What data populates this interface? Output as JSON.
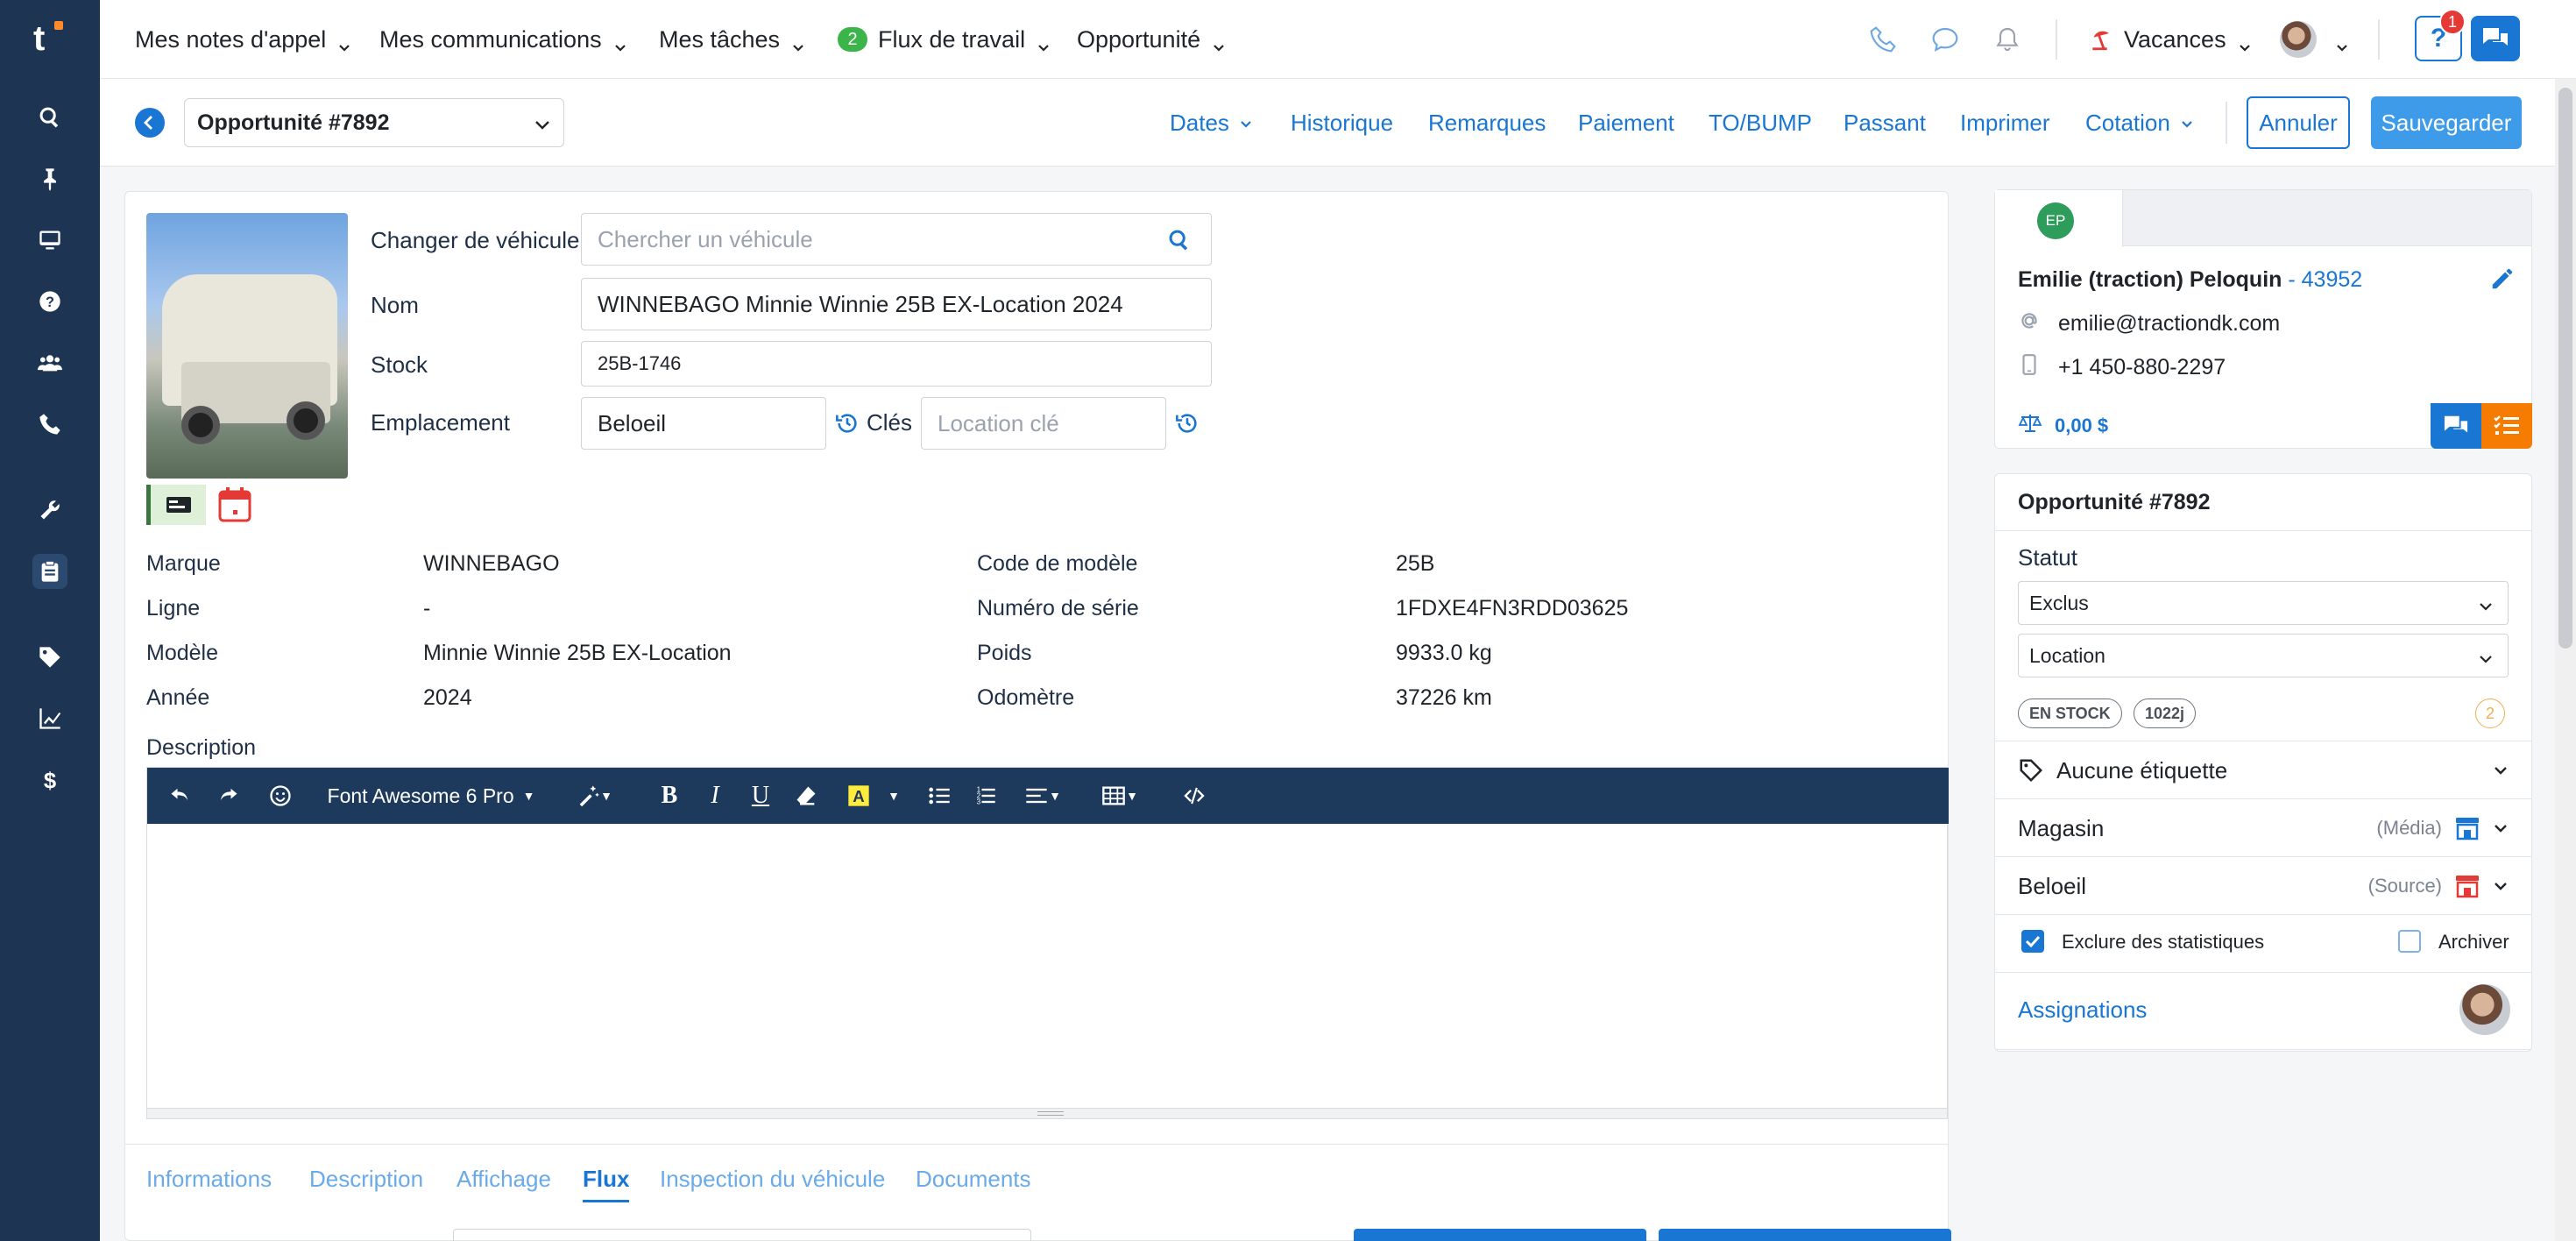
{
  "topnav": {
    "menus": [
      {
        "label": "Mes notes d'appel"
      },
      {
        "label": "Mes communications"
      },
      {
        "label": "Mes tâches"
      },
      {
        "label": "Flux de travail",
        "badge": "2"
      },
      {
        "label": "Opportunité"
      }
    ],
    "vacances_label": "Vacances",
    "help_label": "?",
    "notif_count": "1"
  },
  "subheader": {
    "opportunity_select": "Opportunité #7892",
    "tabs": [
      "Dates",
      "Historique",
      "Remarques",
      "Paiement",
      "TO/BUMP",
      "Passant",
      "Imprimer",
      "Cotation"
    ],
    "cancel_label": "Annuler",
    "save_label": "Sauvegarder"
  },
  "vehicle": {
    "change_label": "Changer de véhicule",
    "search_placeholder": "Chercher un véhicule",
    "nom_label": "Nom",
    "nom_value": "WINNEBAGO Minnie Winnie 25B EX-Location 2024",
    "stock_label": "Stock",
    "stock_value": "25B-1746",
    "emplacement_label": "Emplacement",
    "emplacement_value": "Beloeil",
    "cles_label": "Clés",
    "cles_placeholder": "Location clé"
  },
  "specs": {
    "left": [
      {
        "label": "Marque",
        "value": "WINNEBAGO"
      },
      {
        "label": "Ligne",
        "value": "-"
      },
      {
        "label": "Modèle",
        "value": "Minnie Winnie 25B EX-Location"
      },
      {
        "label": "Année",
        "value": "2024"
      }
    ],
    "right": [
      {
        "label": "Code de modèle",
        "value": "25B"
      },
      {
        "label": "Numéro de série",
        "value": "1FDXE4FN3RDD03625"
      },
      {
        "label": "Poids",
        "value": "9933.0 kg"
      },
      {
        "label": "Odomètre",
        "value": "37226 km"
      }
    ]
  },
  "description": {
    "label": "Description",
    "font_name": "Font Awesome 6 Pro"
  },
  "bottom_tabs": [
    "Informations",
    "Description",
    "Affichage",
    "Flux",
    "Inspection du véhicule",
    "Documents"
  ],
  "contact": {
    "initials": "EP",
    "name": "Emilie (traction) Peloquin",
    "id": " - 43952",
    "email": "emilie@tractiondk.com",
    "phone": "+1 450-880-2297",
    "balance": "0,00 $"
  },
  "opportunity": {
    "title": "Opportunité #7892",
    "statut_label": "Statut",
    "statut_value": "Exclus",
    "type_value": "Location",
    "pill_stock": "EN STOCK",
    "pill_days": "1022j",
    "count": "2",
    "tags_label": "Aucune étiquette",
    "magasin_label": "Magasin",
    "magasin_sub": "(Média)",
    "source_label": "Beloeil",
    "source_sub": "(Source)",
    "exclude_label": "Exclure des statistiques",
    "exclude_checked": true,
    "archive_label": "Archiver",
    "archive_checked": false,
    "assign_label": "Assignations"
  },
  "colors": {
    "sidebar": "#1d3553",
    "accent": "#1976d2",
    "save": "#3d9be9",
    "badge_green": "#3bb54a",
    "orange": "#f57c00"
  }
}
